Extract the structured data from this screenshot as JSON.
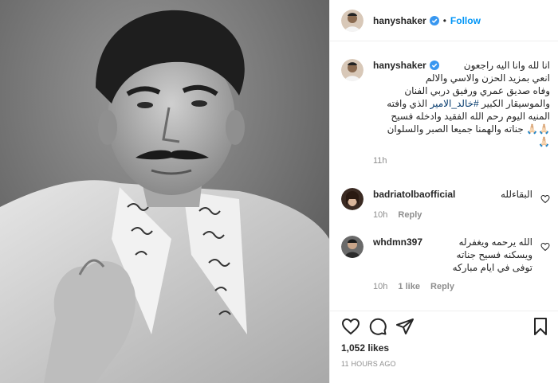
{
  "post": {
    "username": "hanyshaker",
    "follow_label": "Follow",
    "dot": "•",
    "caption": {
      "username": "hanyshaker",
      "line1": "انا لله وانا اليه راجعون",
      "line2": "انعي بمزيد الحزن والاسي والالم",
      "line3": "وفاه صديق عمري ورفيق دربي الفنان",
      "line4_pre": "والموسيقار الكبير ",
      "hashtag": "#خالد_الامير",
      "line4_post": " الذي وافته",
      "line5": "المنيه اليوم رحم الله الفقيد وادخله فسيح",
      "line6": "جناته والهمنا جميعا الصبر والسلوان",
      "time": "11h"
    },
    "comments": [
      {
        "username": "badriatolbaofficial",
        "text": "البقاءلله",
        "time": "10h",
        "reply": "Reply"
      },
      {
        "username": "whdmn397",
        "line1": "الله يرحمه ويغفرله",
        "line2": "ويسكنه فسيح جناته",
        "line3": "توفى في ايام مباركه",
        "time": "10h",
        "likes": "1 like",
        "reply": "Reply"
      }
    ],
    "likes": "1,052 likes",
    "posted": "11 HOURS AGO"
  },
  "colors": {
    "accent": "#0095f6",
    "verified": "#3897f0",
    "hashtag": "#00376b",
    "muted": "#8e8e8e"
  },
  "icons": [
    "verified-badge-icon",
    "heart-icon",
    "comment-icon",
    "share-icon",
    "bookmark-icon"
  ]
}
